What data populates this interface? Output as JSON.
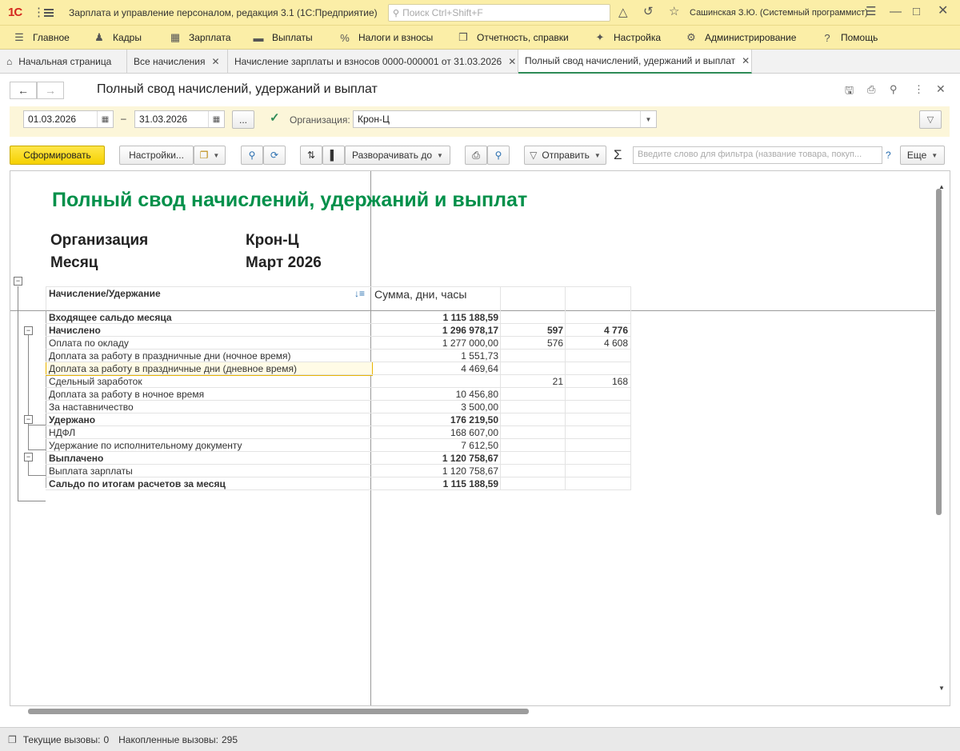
{
  "titlebar": {
    "logo": "1С",
    "app_title": "Зарплата и управление персоналом, редакция 3.1  (1С:Предприятие)",
    "search_placeholder": "Поиск Ctrl+Shift+F",
    "user": "Сашинская З.Ю. (Системный программист)"
  },
  "menu": {
    "items": [
      {
        "label": "Главное",
        "icon": "hamburger-icon"
      },
      {
        "label": "Кадры",
        "icon": "people-icon"
      },
      {
        "label": "Зарплата",
        "icon": "calculator-icon"
      },
      {
        "label": "Выплаты",
        "icon": "card-icon"
      },
      {
        "label": "Налоги и взносы",
        "icon": "percent-icon"
      },
      {
        "label": "Отчетность, справки",
        "icon": "reports-icon"
      },
      {
        "label": "Настройка",
        "icon": "wrench-icon"
      },
      {
        "label": "Администрирование",
        "icon": "gear-icon"
      },
      {
        "label": "Помощь",
        "icon": "question-icon"
      }
    ]
  },
  "tabs": [
    {
      "label": "Начальная страница",
      "icon": "home-icon"
    },
    {
      "label": "Все начисления"
    },
    {
      "label": "Начисление зарплаты и взносов 0000-000001 от 31.03.2026"
    },
    {
      "label": "Полный свод начислений, удержаний и выплат",
      "active": true
    }
  ],
  "form": {
    "title": "Полный свод начислений, удержаний и выплат",
    "date_from": "01.03.2026",
    "date_sep": "–",
    "date_to": "31.03.2026",
    "period_btn": "...",
    "org_label": "Организация:",
    "org_value": "Крон-Ц",
    "org_checked": true
  },
  "toolbar": {
    "generate": "Сформировать",
    "settings": "Настройки...",
    "expand_to": "Разворачивать до",
    "send": "Отправить",
    "sigma": "Σ",
    "filter_placeholder": "Введите слово для фильтра (название товара, покуп...",
    "help": "?",
    "more": "Еще"
  },
  "report": {
    "title": "Полный свод начислений, удержаний и выплат",
    "org_label": "Организация",
    "org_value": "Крон-Ц",
    "month_label": "Месяц",
    "month_value": "Март 2026",
    "col1_header": "Начисление/Удержание",
    "col2_header": "Сумма, дни, часы",
    "rows": [
      {
        "name": "Входящее сальдо месяца",
        "sum": "1 115 188,59",
        "days": "",
        "hours": "",
        "bold": true
      },
      {
        "name": "Начислено",
        "sum": "1 296 978,17",
        "days": "597",
        "hours": "4 776",
        "bold": true
      },
      {
        "name": "Оплата по окладу",
        "sum": "1 277 000,00",
        "days": "576",
        "hours": "4 608"
      },
      {
        "name": "Доплата за работу в праздничные дни (ночное время)",
        "sum": "1 551,73",
        "days": "",
        "hours": ""
      },
      {
        "name": "Доплата за работу в праздничные дни (дневное время)",
        "sum": "4 469,64",
        "days": "",
        "hours": "",
        "selected": true
      },
      {
        "name": "Сдельный заработок",
        "sum": "",
        "days": "21",
        "hours": "168"
      },
      {
        "name": "Доплата за работу в ночное время",
        "sum": "10 456,80",
        "days": "",
        "hours": ""
      },
      {
        "name": "За наставничество",
        "sum": "3 500,00",
        "days": "",
        "hours": ""
      },
      {
        "name": "Удержано",
        "sum": "176 219,50",
        "days": "",
        "hours": "",
        "bold": true
      },
      {
        "name": "НДФЛ",
        "sum": "168 607,00",
        "days": "",
        "hours": ""
      },
      {
        "name": "Удержание по исполнительному документу",
        "sum": "7 612,50",
        "days": "",
        "hours": ""
      },
      {
        "name": "Выплачено",
        "sum": "1 120 758,67",
        "days": "",
        "hours": "",
        "bold": true
      },
      {
        "name": "Выплата зарплаты",
        "sum": "1 120 758,67",
        "days": "",
        "hours": ""
      },
      {
        "name": "Сальдо по итогам расчетов за месяц",
        "sum": "1 115 188,59",
        "days": "",
        "hours": "",
        "bold": true
      }
    ]
  },
  "statusbar": {
    "current_label": "Текущие вызовы:",
    "current_value": "0",
    "accum_label": "Накопленные вызовы:",
    "accum_value": "295"
  },
  "colors": {
    "accent_yellow": "#fbeea7",
    "report_title_green": "#00904a",
    "primary_button": "#f5d100"
  }
}
